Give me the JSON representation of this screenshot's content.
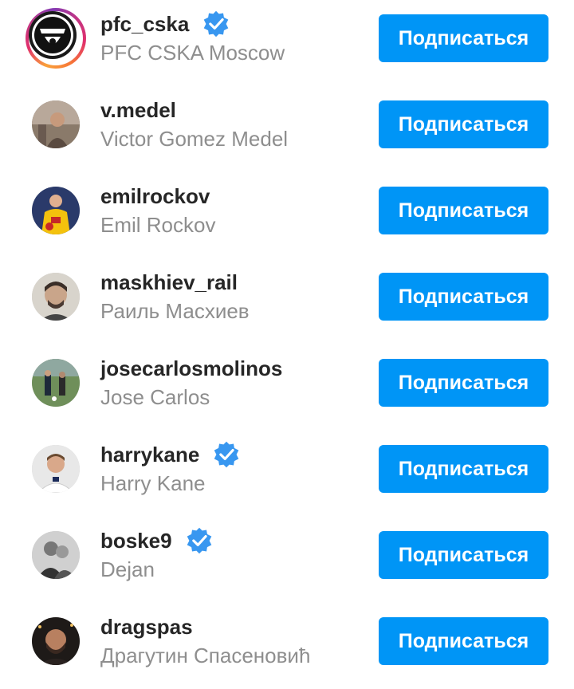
{
  "suggestions": [
    {
      "username": "pfc_cska",
      "full_name": "PFC CSKA Moscow",
      "verified": true,
      "follow_label": "Подписаться",
      "has_story": true
    },
    {
      "username": "v.medel",
      "full_name": "Victor Gomez Medel",
      "verified": false,
      "follow_label": "Подписаться",
      "has_story": false
    },
    {
      "username": "emilrockov",
      "full_name": "Emil Rockov",
      "verified": false,
      "follow_label": "Подписаться",
      "has_story": false
    },
    {
      "username": "maskhiev_rail",
      "full_name": "Раиль Масхиев",
      "verified": false,
      "follow_label": "Подписаться",
      "has_story": false
    },
    {
      "username": "josecarlosmolinos",
      "full_name": "Jose Carlos",
      "verified": false,
      "follow_label": "Подписаться",
      "has_story": false
    },
    {
      "username": "harrykane",
      "full_name": "Harry Kane",
      "verified": true,
      "follow_label": "Подписаться",
      "has_story": false
    },
    {
      "username": "boske9",
      "full_name": "Dejan",
      "verified": true,
      "follow_label": "Подписаться",
      "has_story": false
    },
    {
      "username": "dragspas",
      "full_name": "Драгутин Спасеновић",
      "verified": false,
      "follow_label": "Подписаться",
      "has_story": false
    }
  ],
  "colors": {
    "follow_button": "#0095f6",
    "verified_badge": "#3897f0",
    "username_text": "#262626",
    "fullname_text": "#8e8e8e"
  }
}
